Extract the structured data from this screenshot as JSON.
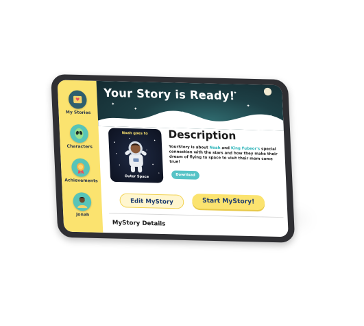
{
  "sidebar": {
    "items": [
      {
        "label": "My Stories",
        "icon": "book-heart-icon"
      },
      {
        "label": "Characters",
        "icon": "alien-icon"
      },
      {
        "label": "Achievements",
        "icon": "medal-icon"
      },
      {
        "label": "Jonah",
        "icon": "avatar-icon"
      }
    ]
  },
  "header": {
    "title": "Your Story is Ready!"
  },
  "cover": {
    "title": "Noah goes to",
    "subtitle": "Outer Space"
  },
  "description": {
    "heading": "Description",
    "text_parts": {
      "p1": "YourStory is about ",
      "name1": "Noah",
      "p2": " and ",
      "name2": "King Fubeor's",
      "p3": " special connection with the stars and how they make their dream of flying to space to visit their mom come true!"
    },
    "download_label": "Download"
  },
  "actions": {
    "edit_label": "Edit MyStory",
    "start_label": "Start MyStory!"
  },
  "details": {
    "heading": "MyStory Details"
  },
  "colors": {
    "sidebar_yellow": "#fbe36f",
    "header_teal_dark": "#142a30",
    "accent_teal": "#56c3c6",
    "link_blue": "#1e3c70"
  }
}
